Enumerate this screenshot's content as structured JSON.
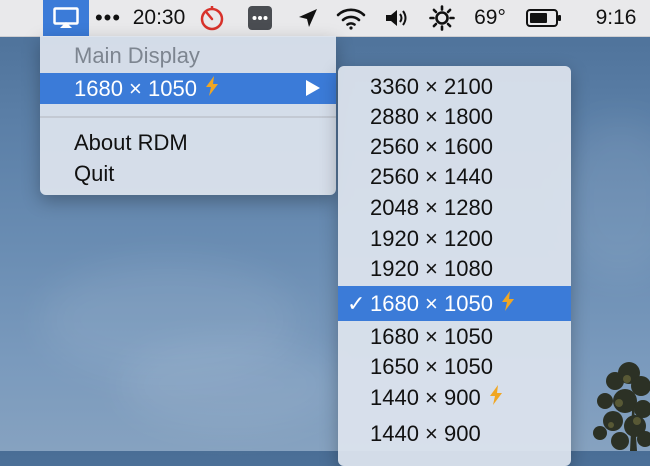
{
  "menubar": {
    "dots": "•••",
    "clock": "20:30",
    "temperature": "69°",
    "time": "9:16"
  },
  "main_menu": {
    "header": "Main Display",
    "selected_resolution": "1680 × 1050",
    "about": "About RDM",
    "quit": "Quit"
  },
  "submenu": {
    "items": [
      {
        "label": "3360 × 2100"
      },
      {
        "label": "2880 × 1800"
      },
      {
        "label": "2560 × 1600"
      },
      {
        "label": "2560 × 1440"
      },
      {
        "label": "2048 × 1280"
      },
      {
        "label": "1920 × 1200"
      },
      {
        "label": "1920 × 1080"
      },
      {
        "label": "1680 × 1050",
        "checked": true,
        "hidpi": true
      },
      {
        "label": "1680 × 1050"
      },
      {
        "label": "1650 × 1050"
      },
      {
        "label": "1440 × 900",
        "hidpi": true
      },
      {
        "label": "1440 × 900"
      }
    ],
    "check_glyph": "✓"
  },
  "colors": {
    "accent": "#3b7bd8",
    "bolt": "#f0a623",
    "timer_red": "#d8322b"
  },
  "icons": {
    "rdm": "display-icon",
    "timer": "timer-icon",
    "ibox": "more-dots-icon",
    "location": "location-arrow-icon",
    "wifi": "wifi-icon",
    "volume": "volume-icon",
    "weather": "sun-icon",
    "battery": "battery-icon",
    "bolt": "lightning-bolt-icon"
  }
}
